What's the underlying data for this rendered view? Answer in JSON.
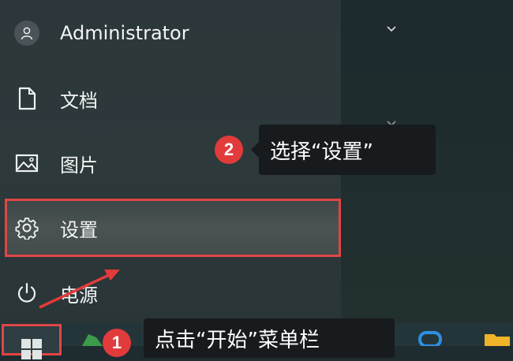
{
  "start_menu": {
    "user": {
      "name": "Administrator",
      "icon": "user-avatar-icon"
    },
    "items": [
      {
        "label": "文档",
        "icon": "document-icon"
      },
      {
        "label": "图片",
        "icon": "pictures-icon"
      },
      {
        "label": "设置",
        "icon": "gear-icon"
      },
      {
        "label": "电源",
        "icon": "power-icon"
      }
    ]
  },
  "annotations": {
    "step2": {
      "number": "2",
      "text": "选择“设置”"
    },
    "step1": {
      "number": "1",
      "text": "点击“开始”菜单栏"
    }
  },
  "colors": {
    "highlight_border": "#e04545",
    "badge": "#e23b3b",
    "tooltip_bg": "#171b1d"
  }
}
